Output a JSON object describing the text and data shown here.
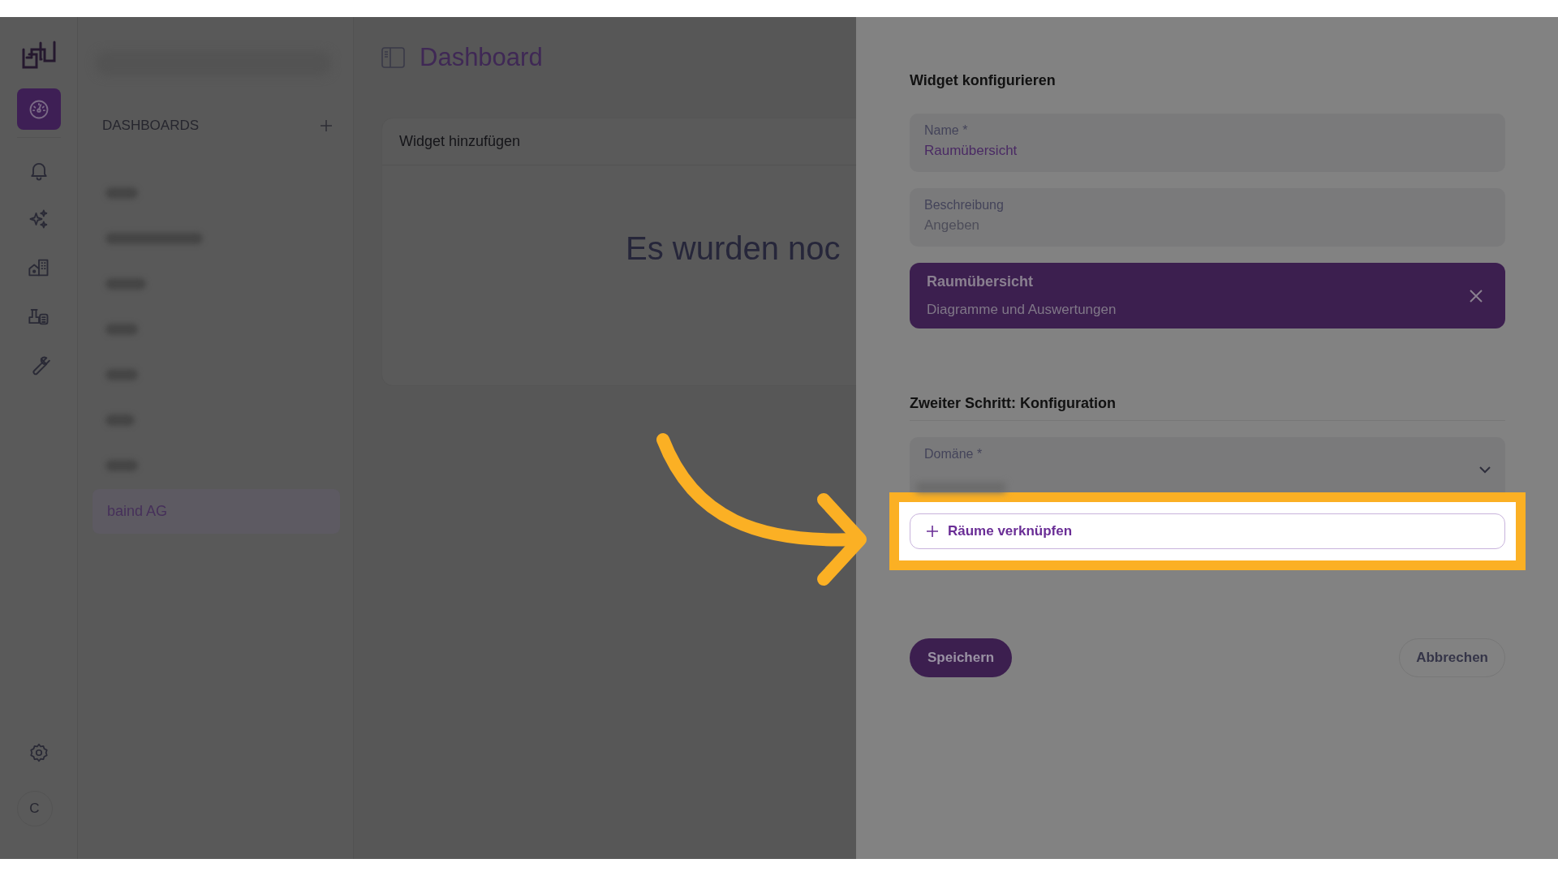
{
  "rail": {
    "items": [
      {
        "selected": true
      },
      {
        "selected": false
      },
      {
        "selected": false
      },
      {
        "selected": false
      },
      {
        "selected": false
      },
      {
        "selected": false
      }
    ],
    "avatar": "C"
  },
  "sidebar": {
    "title": "DASHBOARDS",
    "items": [
      {
        "label": "baind AG",
        "selected": true
      }
    ]
  },
  "main": {
    "title": "Dashboard",
    "card": {
      "title": "Widget hinzufügen",
      "message": "Es wurden noc"
    }
  },
  "panel": {
    "title": "Widget konfigurieren",
    "fields": [
      {
        "label": "Name *",
        "value": "Raumübersicht"
      },
      {
        "label": "Beschreibung",
        "placeholder": "Angeben"
      }
    ],
    "chosen": {
      "title": "Raumübersicht",
      "subtitle": "Diagramme und Auswertungen"
    },
    "section": "Zweiter Schritt: Konfiguration",
    "select": {
      "label": "Domäne *"
    },
    "link_button": "Räume verknüpfen",
    "save": "Speichern",
    "cancel": "Abbrechen"
  }
}
